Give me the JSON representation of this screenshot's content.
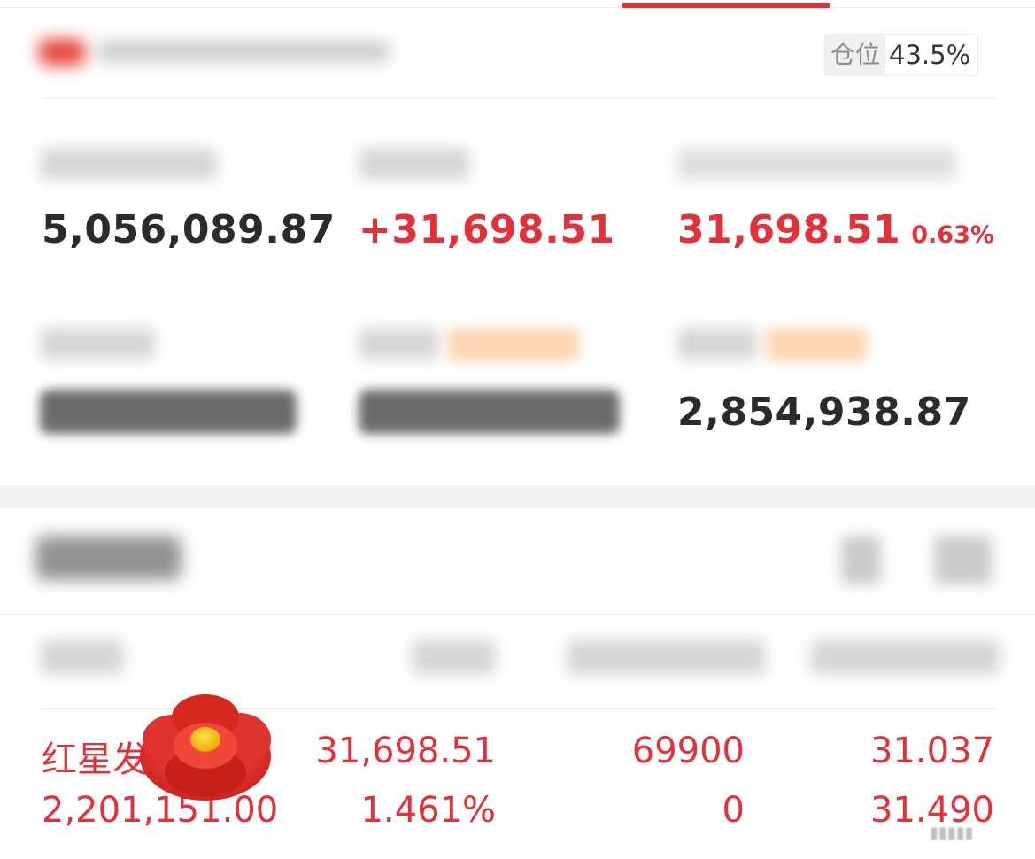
{
  "header": {
    "position_label": "仓位",
    "position_value": "43.5%"
  },
  "summary": {
    "total_assets": "5,056,089.87",
    "total_pnl": "+31,698.51",
    "today_pnl": "31,698.51",
    "today_pnl_pct": "0.63%",
    "withdrawable": "2,854,938.87"
  },
  "holding": {
    "name": "红星发",
    "market_value": "2,201,151.00",
    "pnl": "31,698.51",
    "pnl_pct": "1.461%",
    "position": "69900",
    "available": "0",
    "cost_price": "31.037",
    "current_price": "31.490"
  },
  "colors": {
    "accent_red": "#e0323a",
    "text_dark": "#2b2b2b",
    "tag_orange": "#f7a35c"
  }
}
